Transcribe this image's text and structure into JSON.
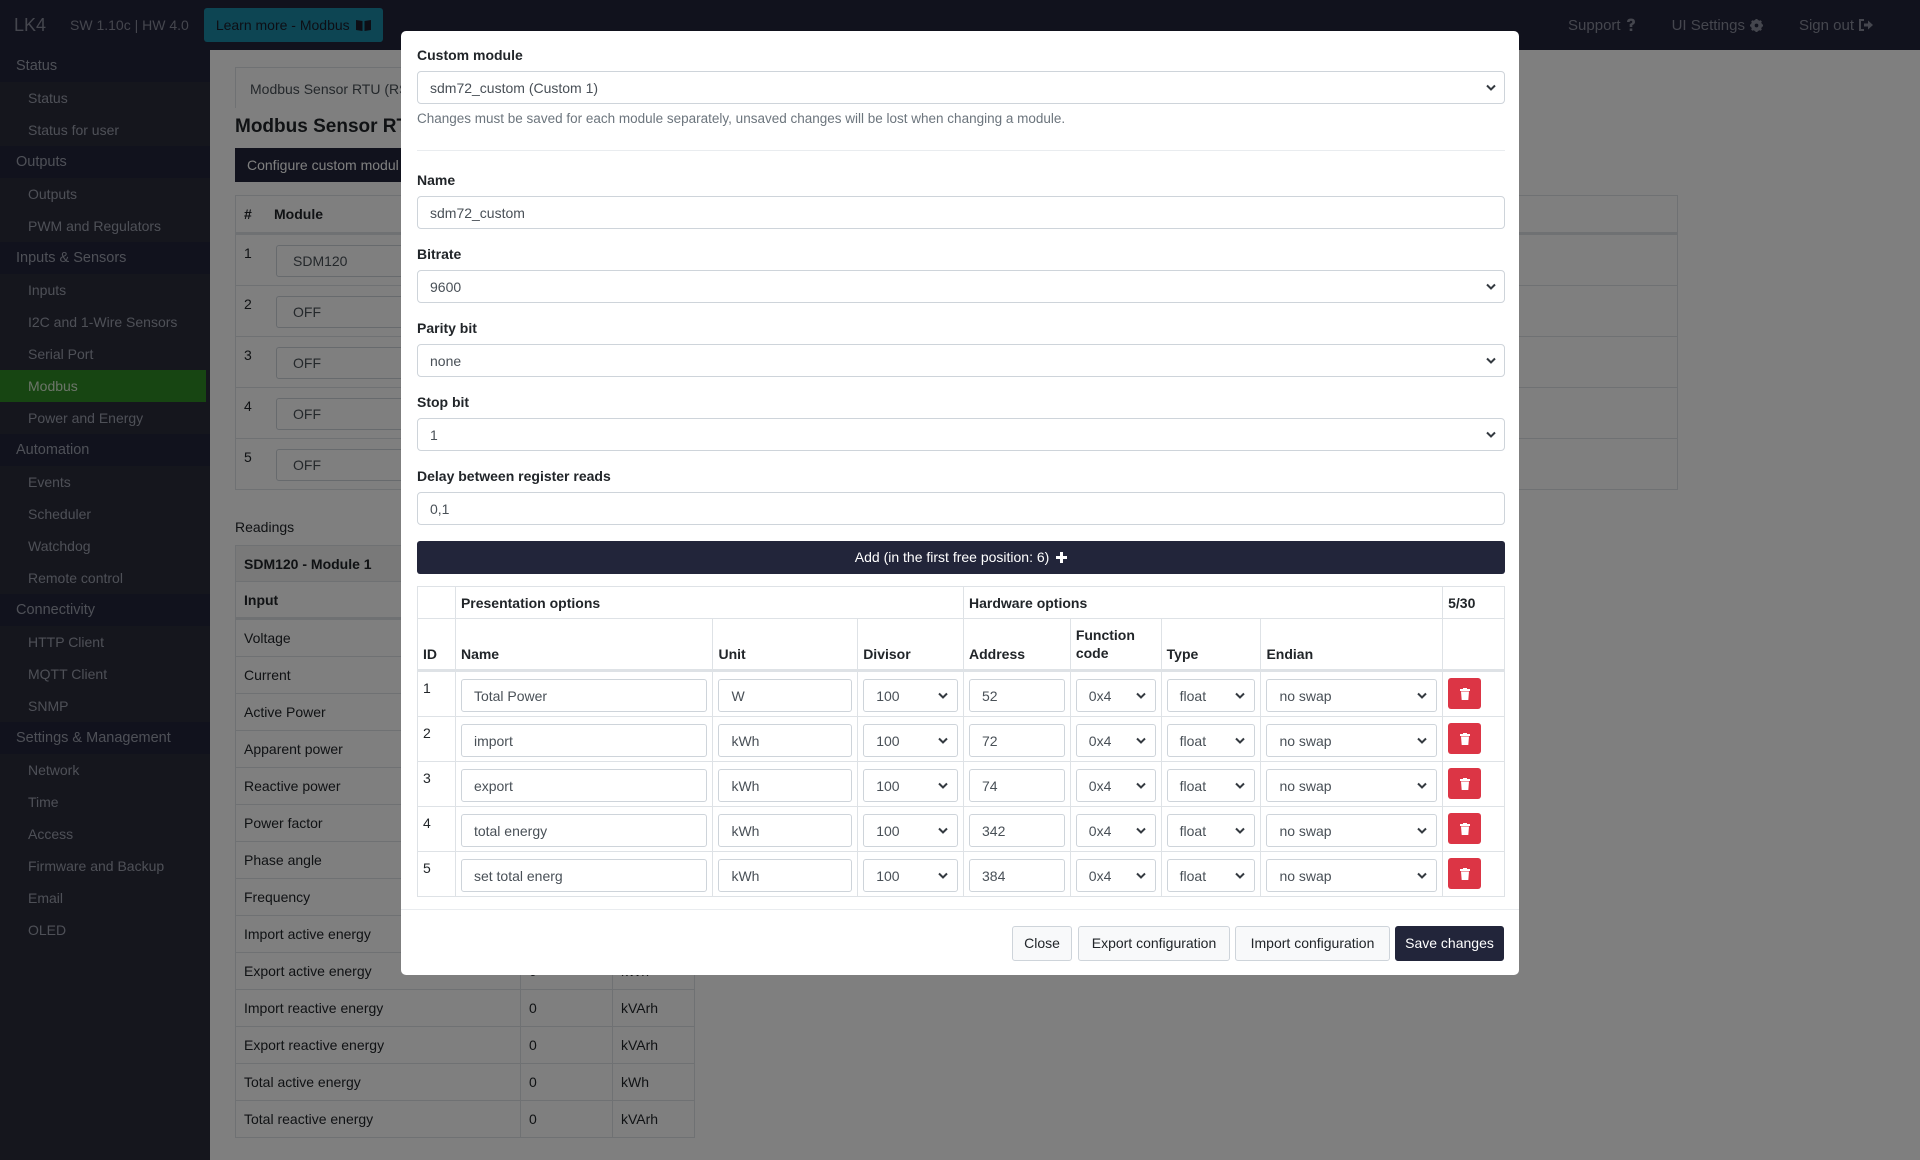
{
  "navbar": {
    "brand": "LK4",
    "version": "SW 1.10c | HW 4.0",
    "learn_more": "Learn more - Modbus",
    "support": "Support",
    "ui_settings": "UI Settings",
    "sign_out": "Sign out"
  },
  "sidebar": {
    "groups": [
      {
        "category": "Status",
        "items": [
          "Status",
          "Status for user"
        ]
      },
      {
        "category": "Outputs",
        "items": [
          "Outputs",
          "PWM and Regulators"
        ]
      },
      {
        "category": "Inputs & Sensors",
        "items": [
          "Inputs",
          "I2C and 1-Wire Sensors",
          "Serial Port",
          "Modbus",
          "Power and Energy"
        ]
      },
      {
        "category": "Automation",
        "items": [
          "Events",
          "Scheduler",
          "Watchdog",
          "Remote control"
        ]
      },
      {
        "category": "Connectivity",
        "items": [
          "HTTP Client",
          "MQTT Client",
          "SNMP"
        ]
      },
      {
        "category": "Settings & Management",
        "items": [
          "Network",
          "Time",
          "Access",
          "Firmware and Backup",
          "Email",
          "OLED"
        ]
      }
    ],
    "active_item": "Modbus"
  },
  "background": {
    "tab": "Modbus Sensor RTU (RS",
    "title": "Modbus Sensor RTU",
    "config_button": "Configure custom modul",
    "module_table": {
      "headers": [
        "#",
        "Module"
      ],
      "rows": [
        {
          "num": "1",
          "module": "SDM120"
        },
        {
          "num": "2",
          "module": "OFF"
        },
        {
          "num": "3",
          "module": "OFF"
        },
        {
          "num": "4",
          "module": "OFF"
        },
        {
          "num": "5",
          "module": "OFF"
        }
      ]
    },
    "readings_label": "Readings",
    "readings_title": "SDM120 - Module 1",
    "readings_header": "Input",
    "readings": [
      {
        "input": "Voltage",
        "value": "",
        "unit": ""
      },
      {
        "input": "Current",
        "value": "",
        "unit": ""
      },
      {
        "input": "Active Power",
        "value": "",
        "unit": ""
      },
      {
        "input": "Apparent power",
        "value": "",
        "unit": ""
      },
      {
        "input": "Reactive power",
        "value": "",
        "unit": ""
      },
      {
        "input": "Power factor",
        "value": "",
        "unit": ""
      },
      {
        "input": "Phase angle",
        "value": "",
        "unit": ""
      },
      {
        "input": "Frequency",
        "value": "",
        "unit": ""
      },
      {
        "input": "Import active energy",
        "value": "",
        "unit": ""
      },
      {
        "input": "Export active energy",
        "value": "0",
        "unit": "kWh"
      },
      {
        "input": "Import reactive energy",
        "value": "0",
        "unit": "kVArh"
      },
      {
        "input": "Export reactive energy",
        "value": "0",
        "unit": "kVArh"
      },
      {
        "input": "Total active energy",
        "value": "0",
        "unit": "kWh"
      },
      {
        "input": "Total reactive energy",
        "value": "0",
        "unit": "kVArh"
      }
    ]
  },
  "modal": {
    "custom_module_label": "Custom module",
    "custom_module_value": "sdm72_custom (Custom 1)",
    "help_text": "Changes must be saved for each module separately, unsaved changes will be lost when changing a module.",
    "name_label": "Name",
    "name_value": "sdm72_custom",
    "bitrate_label": "Bitrate",
    "bitrate_value": "9600",
    "parity_label": "Parity bit",
    "parity_value": "none",
    "stop_label": "Stop bit",
    "stop_value": "1",
    "delay_label": "Delay between register reads",
    "delay_value": "0,1",
    "add_button": "Add (in the first free position: 6)",
    "table": {
      "group_presentation": "Presentation options",
      "group_hardware": "Hardware options",
      "count": "5/30",
      "headers": {
        "id": "ID",
        "name": "Name",
        "unit": "Unit",
        "divisor": "Divisor",
        "address": "Address",
        "function_code": "Function code",
        "type": "Type",
        "endian": "Endian"
      },
      "rows": [
        {
          "id": "1",
          "name": "Total Power",
          "unit": "W",
          "divisor": "100",
          "address": "52",
          "function_code": "0x4",
          "type": "float",
          "endian": "no swap"
        },
        {
          "id": "2",
          "name": "import",
          "unit": "kWh",
          "divisor": "100",
          "address": "72",
          "function_code": "0x4",
          "type": "float",
          "endian": "no swap"
        },
        {
          "id": "3",
          "name": "export",
          "unit": "kWh",
          "divisor": "100",
          "address": "74",
          "function_code": "0x4",
          "type": "float",
          "endian": "no swap"
        },
        {
          "id": "4",
          "name": "total energy",
          "unit": "kWh",
          "divisor": "100",
          "address": "342",
          "function_code": "0x4",
          "type": "float",
          "endian": "no swap"
        },
        {
          "id": "5",
          "name": "set total energ",
          "unit": "kWh",
          "divisor": "100",
          "address": "384",
          "function_code": "0x4",
          "type": "float",
          "endian": "no swap"
        }
      ]
    },
    "footer": {
      "close": "Close",
      "export": "Export configuration",
      "import": "Import configuration",
      "save": "Save changes"
    }
  }
}
